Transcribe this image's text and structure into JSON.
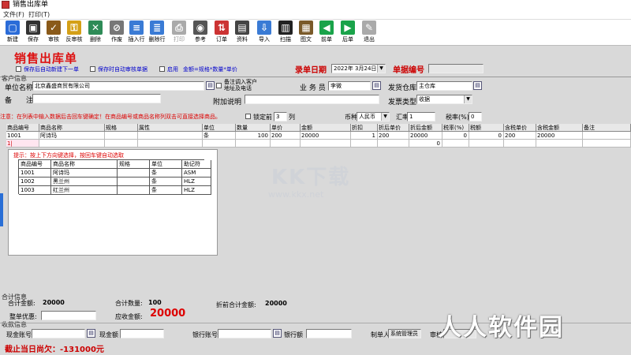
{
  "window": {
    "title": "销售出库单"
  },
  "menu": [
    {
      "label": "文件(F)"
    },
    {
      "label": "打印(T)"
    }
  ],
  "toolbar": [
    {
      "label": "新建",
      "icon": "new-doc-icon",
      "color": "#2b6cd8",
      "glyph": "▢"
    },
    {
      "label": "保存",
      "icon": "save-icon",
      "color": "#333333",
      "glyph": "▣"
    },
    {
      "label": "审核",
      "icon": "audit-icon",
      "color": "#8a5a1a",
      "glyph": "✓"
    },
    {
      "label": "反审核",
      "icon": "unaudit-keys-icon",
      "color": "#d4a017",
      "glyph": "⚿"
    },
    {
      "label": "删除",
      "icon": "delete-icon",
      "color": "#2e8b57",
      "glyph": "✕"
    },
    {
      "label": "作废",
      "icon": "void-icon",
      "color": "#777777",
      "glyph": "⊘"
    },
    {
      "label": "插入行",
      "icon": "insert-row-icon",
      "color": "#3a7bd5",
      "glyph": "≡"
    },
    {
      "label": "删除行",
      "icon": "delete-row-icon",
      "color": "#3a7bd5",
      "glyph": "≣"
    },
    {
      "label": "打印",
      "icon": "print-icon",
      "color": "#aaaaaa",
      "glyph": "⎙",
      "disabled": true
    },
    {
      "label": "参考",
      "icon": "reference-icon",
      "color": "#555555",
      "glyph": "◉"
    },
    {
      "label": "订单",
      "icon": "order-icon",
      "color": "#cc3333",
      "glyph": "⇅"
    },
    {
      "label": "资料",
      "icon": "data-icon",
      "color": "#444444",
      "glyph": "▤"
    },
    {
      "label": "导入",
      "icon": "import-icon",
      "color": "#3a7bd5",
      "glyph": "⇩"
    },
    {
      "label": "扫描",
      "icon": "barcode-icon",
      "color": "#222222",
      "glyph": "▥"
    },
    {
      "label": "图文",
      "icon": "image-text-icon",
      "color": "#7a5a2a",
      "glyph": "▦"
    },
    {
      "label": "前单",
      "icon": "prev-arrow-icon",
      "color": "#1aa34a",
      "glyph": "◀"
    },
    {
      "label": "后单",
      "icon": "next-arrow-icon",
      "color": "#1aa34a",
      "glyph": "▶"
    },
    {
      "label": "退出",
      "icon": "exit-icon",
      "color": "#aaaaaa",
      "glyph": "✎"
    }
  ],
  "header": {
    "title": "销售出库单",
    "opt_autonew": "保存后自动新建下一单",
    "opt_autoaudit": "保存时自动审核单据",
    "opt_enable": "启用",
    "opt_formula": "金额=规格*数量*单价",
    "date_label": "录单日期",
    "date_value": "2022年 3月24日",
    "docno_label": "单据编号",
    "docno_value": ""
  },
  "customer": {
    "section": "客户信息",
    "unit_label": "单位名称",
    "unit_value": "北京鑫盛商贸有限公司",
    "auto_addr": "备注调入客户\n地址及电话",
    "salesman_label": "业 务 员",
    "salesman_value": "李微",
    "warehouse_label": "发货仓库",
    "warehouse_value": "主仓库",
    "remark_label": "备　　注",
    "remark_value": "",
    "extra_label": "附加说明",
    "extra_value": "",
    "invoice_label": "发票类型",
    "invoice_value": "收据"
  },
  "notice": {
    "text": "注意：在列表中输入数据后击回车键确定！在商品编号或商品名称列双击可直接选择商品。",
    "lock_label": "锁定前",
    "lock_value": "3",
    "lock_unit": "列",
    "currency_label": "币种",
    "currency_value": "人民币",
    "rate_label": "汇率",
    "rate_value": "1",
    "tax_label": "税率(%)",
    "tax_value": "0"
  },
  "grid": {
    "columns": [
      "商品编号",
      "商品名称",
      "规格",
      "属性",
      "单位",
      "数量",
      "单价",
      "金额",
      "折扣",
      "折后单价",
      "折后金额",
      "税率(%)",
      "税额",
      "含税单价",
      "含税金额",
      "备注"
    ],
    "rows": [
      [
        "1001",
        "阿诗玛",
        "",
        "",
        "条",
        "100",
        "200",
        "20000",
        "1",
        "200",
        "20000",
        "0",
        "0",
        "200",
        "20000",
        ""
      ]
    ],
    "active_row": "1|",
    "sum_row_value": "0"
  },
  "popup": {
    "hint": "提示：按上下方向键选择，按回车键自动选取",
    "columns": [
      "商品编号",
      "商品名称",
      "规格",
      "单位",
      "助记符"
    ],
    "rows": [
      [
        "1001",
        "阿诗玛",
        "",
        "条",
        "ASM"
      ],
      [
        "1002",
        "黑兰州",
        "",
        "条",
        "HLZ"
      ],
      [
        "1003",
        "红兰州",
        "",
        "条",
        "HLZ"
      ]
    ]
  },
  "summary": {
    "section": "合计信息",
    "total_amount_label": "合计金额:",
    "total_amount_value": "20000",
    "total_qty_label": "合计数量:",
    "total_qty_value": "100",
    "pre_discount_label": "折前合计金额:",
    "pre_discount_value": "20000",
    "whole_discount_label": "整单优惠:",
    "whole_discount_value": "",
    "receivable_label": "应收金额:",
    "receivable_value": "20000"
  },
  "payment": {
    "section": "收款信息",
    "cash_account_label": "现金账号",
    "cash_amount_label": "现金额",
    "bank_account_label": "银行账号",
    "bank_amount_label": "银行额",
    "maker_label": "制单人",
    "maker_value": "系统管理员",
    "reviewer_label": "审核",
    "arrears": "截止当日尚欠：-131000元"
  },
  "watermark": {
    "logo": "KK下载",
    "url": "www.kkx.net",
    "brand": "人人软件园"
  }
}
